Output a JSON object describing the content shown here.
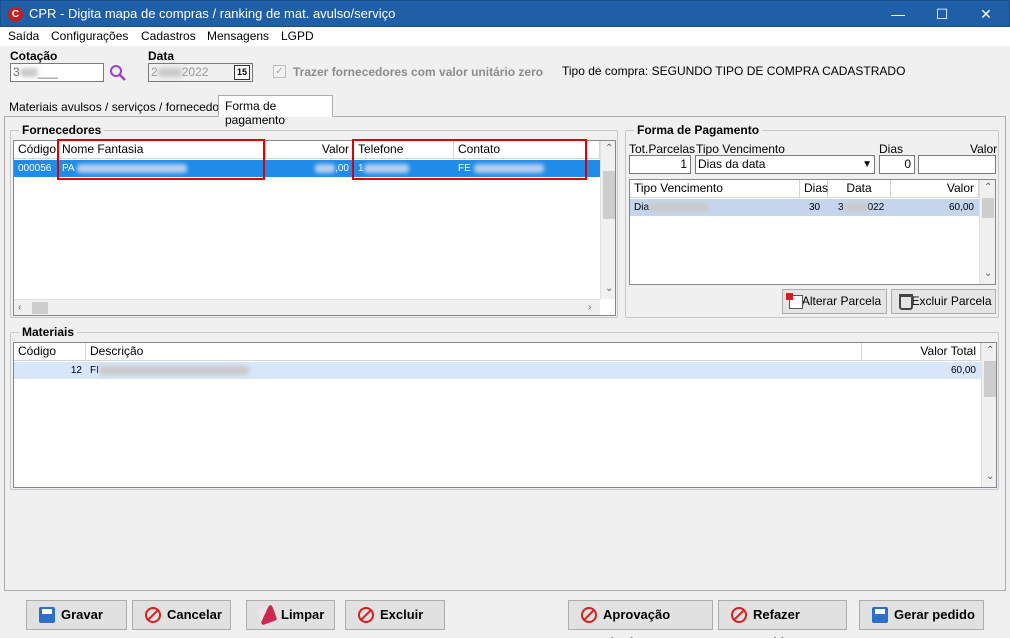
{
  "window": {
    "title": "CPR - Digita mapa de compras / ranking de mat. avulso/serviço",
    "minimize": "—",
    "maximize": "☐",
    "close": "✕"
  },
  "menu": [
    "Saída",
    "Configurações",
    "Cadastros",
    "Mensagens",
    "LGPD"
  ],
  "header": {
    "cotacao_label": "Cotação",
    "cotacao_value": "3",
    "cotacao_suffix": "___",
    "data_label": "Data",
    "data_value_prefix": "2",
    "data_value_suffix": "2022",
    "calendar_day": "15",
    "trazer_label": "Trazer fornecedores com valor unitário zero",
    "tipo_compra": "Tipo de compra: SEGUNDO TIPO DE COMPRA CADASTRADO"
  },
  "tabs": {
    "materiais": "Materiais avulsos / serviços / fornecedores",
    "forma": "Forma de pagamento"
  },
  "fornecedores": {
    "title": "Fornecedores",
    "columns": [
      "Código",
      "Nome Fantasia",
      "Valor",
      "Telefone",
      "Contato"
    ],
    "row": {
      "codigo": "000056",
      "nome": "PA",
      "valor": ",00",
      "telefone": "1",
      "contato": "FE"
    }
  },
  "forma_pagamento": {
    "title": "Forma de Pagamento",
    "tot_parcelas_label": "Tot.Parcelas",
    "tot_parcelas_value": "1",
    "tipo_vencimento_label": "Tipo Vencimento",
    "tipo_vencimento_value": "Dias da data",
    "dias_label": "Dias",
    "dias_value": "0",
    "valor_label": "Valor",
    "columns": [
      "Tipo Vencimento",
      "Dias",
      "Data",
      "Valor"
    ],
    "row": {
      "tipo": "Dia",
      "dias": "30",
      "data_prefix": "3",
      "data_suffix": "022",
      "valor": "60,00"
    },
    "alterar_label": "Alterar Parcela",
    "excluir_label": "Excluir Parcela"
  },
  "materiais": {
    "title": "Materiais",
    "columns": [
      "Código",
      "Descrição",
      "Valor Total"
    ],
    "row": {
      "codigo": "12",
      "descricao": "FI",
      "valor": "60,00"
    }
  },
  "buttons": {
    "gravar": "Gravar",
    "cancelar": "Cancelar",
    "limpar": "Limpar",
    "excluir": "Excluir",
    "aprovacao": "Aprovação técnica",
    "refazer": "Refazer ranking",
    "gerar": "Gerar pedido"
  }
}
